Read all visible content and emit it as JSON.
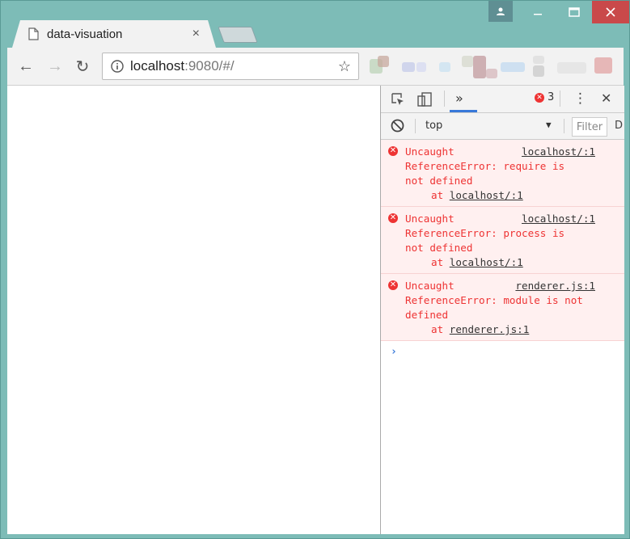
{
  "window": {
    "controls": [
      "profile",
      "minimize",
      "maximize",
      "close"
    ]
  },
  "tab": {
    "title": "data-visuation",
    "close_label": "×",
    "icon": "page-icon"
  },
  "toolbar": {
    "back": "←",
    "forward": "→",
    "reload": "↻",
    "url_host": "localhost",
    "url_path": ":9080/#/",
    "star": "☆"
  },
  "devtools": {
    "more": "»",
    "error_count": "3",
    "kebab": "⋮",
    "close": "✕",
    "context": "top",
    "context_arrow": "▼",
    "filter_placeholder": "Filter",
    "cut_label": "D",
    "messages": [
      {
        "text": "Uncaught\nReferenceError: require is\nnot defined",
        "source": "localhost/:1",
        "at_prefix": "at ",
        "at_link": "localhost/:1"
      },
      {
        "text": "Uncaught\nReferenceError: process is\nnot defined",
        "source": "localhost/:1",
        "at_prefix": "at ",
        "at_link": "localhost/:1"
      },
      {
        "text": "Uncaught\nReferenceError: module is not\ndefined",
        "source": "renderer.js:1",
        "at_prefix": "at ",
        "at_link": "renderer.js:1"
      }
    ],
    "prompt": "›"
  },
  "colors": {
    "frame": "#7dbcb7",
    "error_red": "#e33333",
    "error_bg": "#fff0f0",
    "accent_blue": "#3879d9"
  }
}
